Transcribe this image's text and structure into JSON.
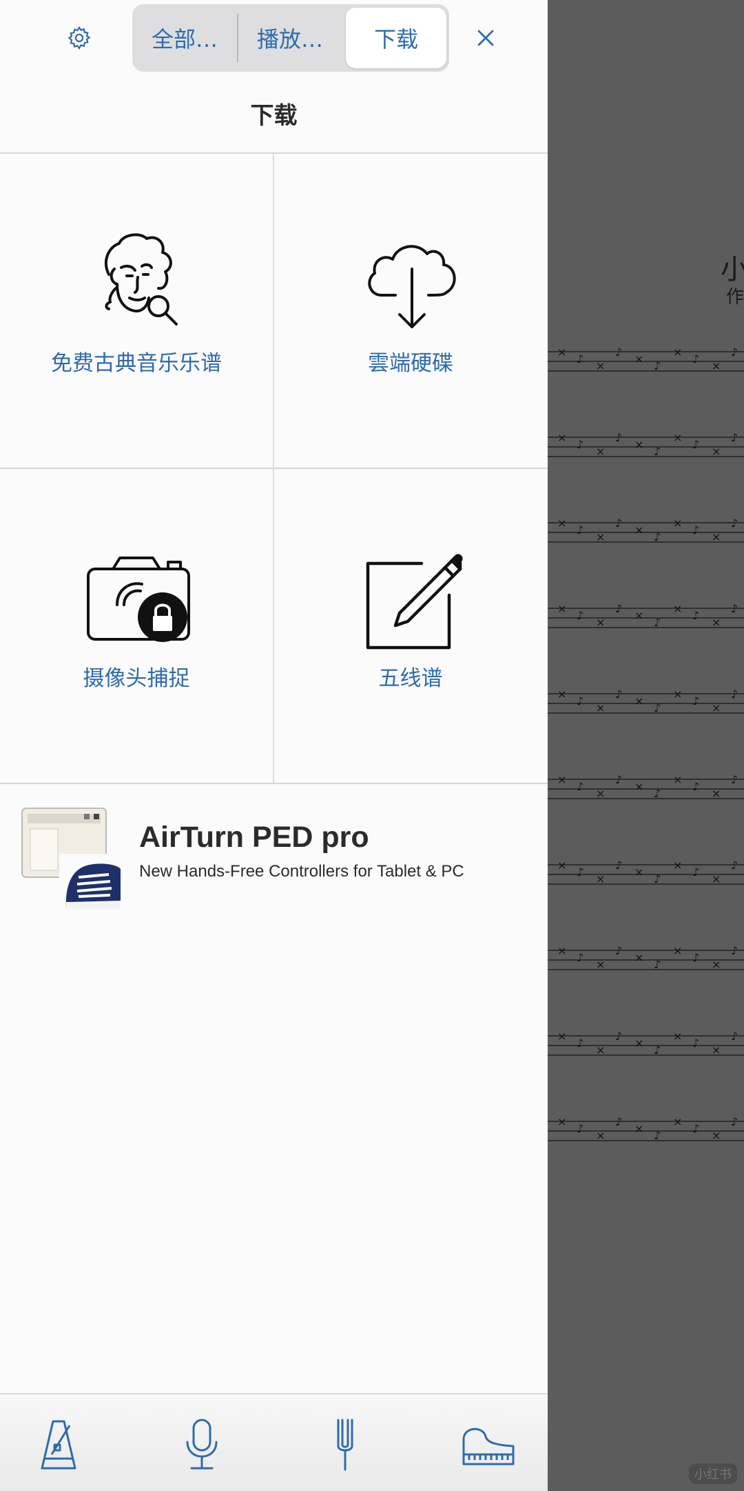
{
  "header": {
    "settings_icon": "gear-icon",
    "segments": [
      "全部…",
      "播放…",
      "下载"
    ],
    "selected_segment": "下载",
    "close_icon": "close-icon"
  },
  "page": {
    "title": "下载"
  },
  "tiles": [
    {
      "label": "免费古典音乐乐谱",
      "icon": "composer-search-icon"
    },
    {
      "label": "雲端硬碟",
      "icon": "cloud-download-icon"
    },
    {
      "label": "摄像头捕捉",
      "icon": "camera-lock-icon"
    },
    {
      "label": "五线谱",
      "icon": "edit-pencil-icon"
    }
  ],
  "ad": {
    "title": "AirTurn PED pro",
    "subtitle": "New Hands-Free Controllers for Tablet & PC",
    "image": "sneaker-pedal-image"
  },
  "toolbar": {
    "items": [
      "metronome-icon",
      "microphone-icon",
      "tuning-fork-icon",
      "piano-icon"
    ]
  },
  "background": {
    "title_glyph": "小",
    "subtitle_glyph": "作",
    "watermark": "小红书"
  },
  "colors": {
    "accent": "#2e6bab",
    "panel": "#fbfbfb",
    "dim": "#5c5c5c"
  }
}
